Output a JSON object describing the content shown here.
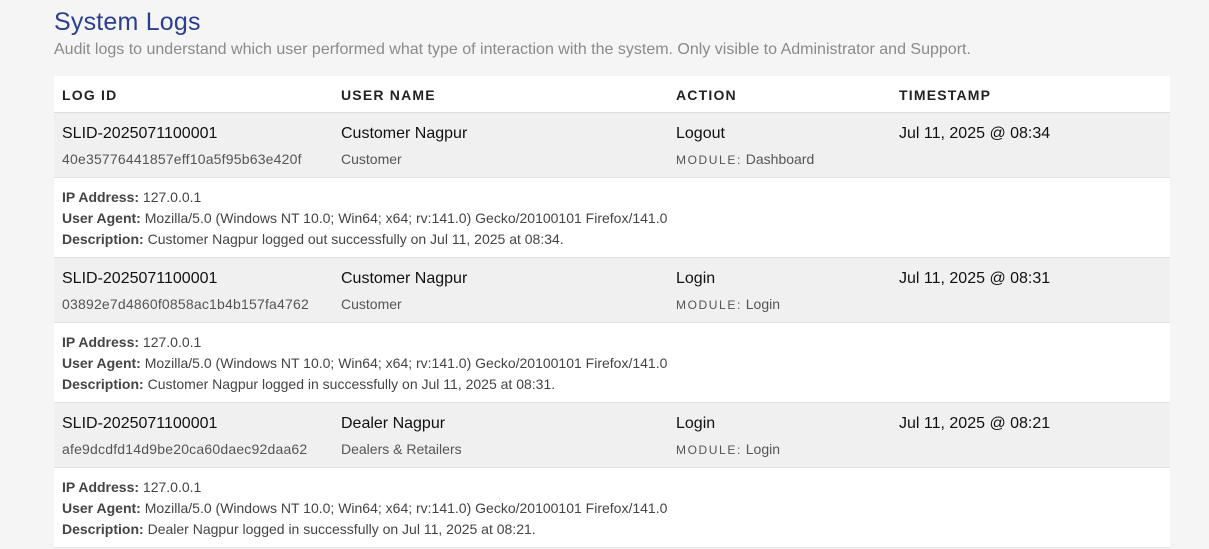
{
  "header": {
    "title": "System Logs",
    "subtitle": "Audit logs to understand which user performed what type of interaction with the system. Only visible to Administrator and Support."
  },
  "columns": [
    "LOG ID",
    "USER NAME",
    "ACTION",
    "TIMESTAMP"
  ],
  "labels": {
    "module": "MODULE:",
    "ip_address": "IP Address:",
    "user_agent": "User Agent:",
    "description": "Description:"
  },
  "logs": [
    {
      "log_id": "SLID-2025071100001",
      "hash": "40e35776441857eff10a5f95b63e420f",
      "user_name": "Customer Nagpur",
      "role": "Customer",
      "action": "Logout",
      "module": "Dashboard",
      "timestamp": "Jul 11, 2025 @ 08:34",
      "ip_address": "127.0.0.1",
      "user_agent": "Mozilla/5.0 (Windows NT 10.0; Win64; x64; rv:141.0) Gecko/20100101 Firefox/141.0",
      "description": "Customer Nagpur logged out successfully on Jul 11, 2025 at 08:34."
    },
    {
      "log_id": "SLID-2025071100001",
      "hash": "03892e7d4860f0858ac1b4b157fa4762",
      "user_name": "Customer Nagpur",
      "role": "Customer",
      "action": "Login",
      "module": "Login",
      "timestamp": "Jul 11, 2025 @ 08:31",
      "ip_address": "127.0.0.1",
      "user_agent": "Mozilla/5.0 (Windows NT 10.0; Win64; x64; rv:141.0) Gecko/20100101 Firefox/141.0",
      "description": "Customer Nagpur logged in successfully on Jul 11, 2025 at 08:31."
    },
    {
      "log_id": "SLID-2025071100001",
      "hash": "afe9dcdfd14d9be20ca60daec92daa62",
      "user_name": "Dealer Nagpur",
      "role": "Dealers & Retailers",
      "action": "Login",
      "module": "Login",
      "timestamp": "Jul 11, 2025 @ 08:21",
      "ip_address": "127.0.0.1",
      "user_agent": "Mozilla/5.0 (Windows NT 10.0; Win64; x64; rv:141.0) Gecko/20100101 Firefox/141.0",
      "description": "Dealer Nagpur logged in successfully on Jul 11, 2025 at 08:21."
    }
  ]
}
